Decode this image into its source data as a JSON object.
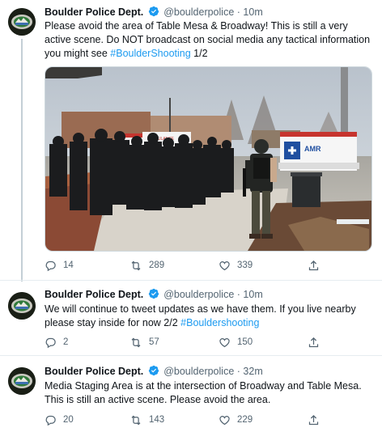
{
  "colors": {
    "link": "#1d9bf0",
    "verified": "#1d9bf0",
    "muted": "#536471",
    "divider": "#e6ecf0"
  },
  "tweets": [
    {
      "name": "Boulder Police Dept.",
      "handle": "@boulderpolice",
      "separator": "·",
      "time": "10m",
      "text": "Please avoid the area of Table Mesa & Broadway! This is still a very active scene. Do NOT broadcast on social media any tactical information you might see ",
      "hashtag": "#BoulderShooting",
      "suffix": " 1/2",
      "has_media": true,
      "media_labels": {
        "ambulance": "AMBULANCE",
        "amr": "AMR"
      },
      "stats": {
        "replies": "14",
        "retweets": "289",
        "likes": "339"
      }
    },
    {
      "name": "Boulder Police Dept.",
      "handle": "@boulderpolice",
      "separator": "·",
      "time": "10m",
      "text": "We will continue to tweet updates as we have them. If you live nearby please stay inside for now 2/2 ",
      "hashtag": "#Bouldershooting",
      "suffix": "",
      "stats": {
        "replies": "2",
        "retweets": "57",
        "likes": "150"
      }
    },
    {
      "name": "Boulder Police Dept.",
      "handle": "@boulderpolice",
      "separator": "·",
      "time": "32m",
      "text": "Media Staging Area is at the intersection of Broadway and Table Mesa. This is still an active scene. Please avoid the area.",
      "hashtag": "",
      "suffix": "",
      "stats": {
        "replies": "20",
        "retweets": "143",
        "likes": "229"
      }
    }
  ]
}
